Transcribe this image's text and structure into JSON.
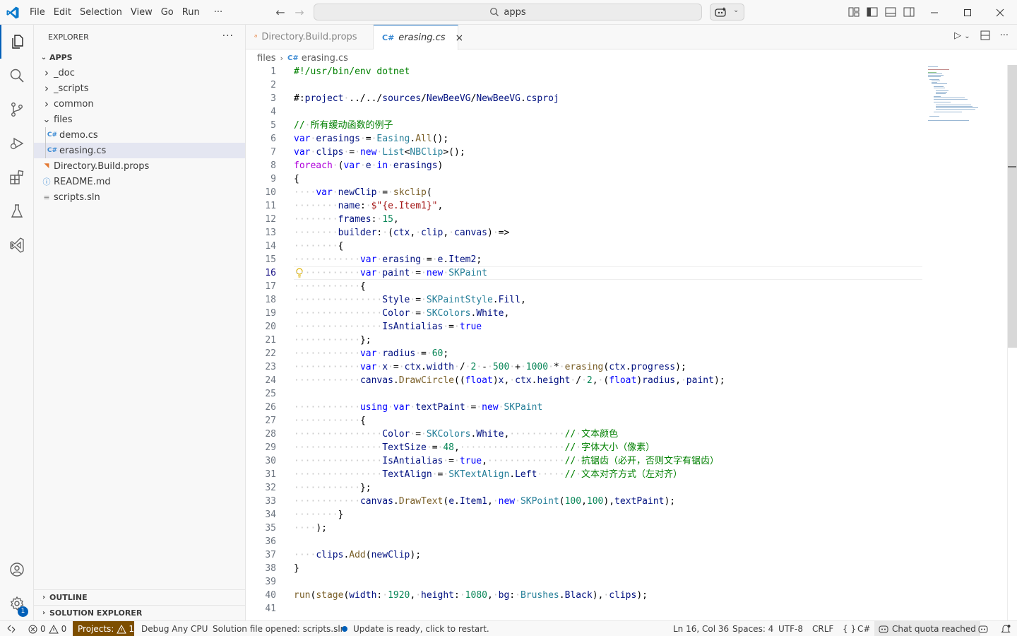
{
  "titlebar": {
    "menus": [
      "File",
      "Edit",
      "Selection",
      "View",
      "Go",
      "Run",
      "···"
    ],
    "search_text": "apps"
  },
  "explorer": {
    "title": "EXPLORER",
    "more": "···",
    "root": "APPS",
    "items": [
      {
        "label": "_doc",
        "kind": "folder-collapsed",
        "indent": 0
      },
      {
        "label": "_scripts",
        "kind": "folder-collapsed",
        "indent": 0
      },
      {
        "label": "common",
        "kind": "folder-collapsed",
        "indent": 0
      },
      {
        "label": "files",
        "kind": "folder-open",
        "indent": 0
      },
      {
        "label": "demo.cs",
        "kind": "cs",
        "indent": 1
      },
      {
        "label": "erasing.cs",
        "kind": "cs",
        "indent": 1,
        "selected": true
      },
      {
        "label": "Directory.Build.props",
        "kind": "rss",
        "indent": 0
      },
      {
        "label": "README.md",
        "kind": "info",
        "indent": 0
      },
      {
        "label": "scripts.sln",
        "kind": "lines",
        "indent": 0
      }
    ],
    "outline": "OUTLINE",
    "solution_explorer": "SOLUTION EXPLORER"
  },
  "tabs": [
    {
      "label": "Directory.Build.props",
      "icon": "rss-icon"
    },
    {
      "label": "erasing.cs",
      "icon": "csharp-icon",
      "close": "×"
    }
  ],
  "breadcrumb": {
    "folder": "files",
    "file": "erasing.cs"
  },
  "editor": {
    "cursor_line": 16,
    "lines": [
      "#!/usr/bin/env dotnet",
      "",
      "#:project ../../sources/NewBeeVG/NewBeeVG.csproj",
      "",
      "// 所有缓动函数的例子",
      "var erasings = Easing.All();",
      "var clips = new List<NBClip>();",
      "foreach (var e in erasings)",
      "{",
      "    var newClip = skclip(",
      "        name: $\"{e.Item1}\",",
      "        frames: 15,",
      "        builder: (ctx, clip, canvas) =>",
      "        {",
      "            var erasing = e.Item2;",
      "            var paint = new SKPaint",
      "            {",
      "                Style = SKPaintStyle.Fill,",
      "                Color = SKColors.White,",
      "                IsAntialias = true",
      "            };",
      "            var radius = 60;",
      "            var x = ctx.width / 2 - 500 + 1000 * erasing(ctx.progress);",
      "            canvas.DrawCircle((float)x, ctx.height / 2, (float)radius, paint);",
      "",
      "            using var textPaint = new SKPaint",
      "            {",
      "                Color = SKColors.White,          // 文本颜色",
      "                TextSize = 48,                   // 字体大小（像素）",
      "                IsAntialias = true,              // 抗锯齿（必开，否则文字有锯齿）",
      "                TextAlign = SKTextAlign.Left     // 文本对齐方式（左对齐）",
      "            };",
      "            canvas.DrawText(e.Item1, new SKPoint(100,100),textPaint);",
      "        }",
      "    );",
      "",
      "    clips.Add(newClip);",
      "}",
      "",
      "run(stage(width: 1920, height: 1080, bg: Brushes.Black), clips);",
      ""
    ]
  },
  "statusbar": {
    "errors": "0",
    "warnings": "0",
    "projects": "Projects:",
    "projects_warn": "1",
    "debug": "Debug Any CPU",
    "solution": "Solution file opened: scripts.sln",
    "update": "Update is ready, click to restart.",
    "position": "Ln 16, Col 36",
    "spaces": "Spaces: 4",
    "encoding": "UTF-8",
    "eol": "CRLF",
    "braces": "{ }",
    "language": "C#",
    "chat": "Chat quota reached",
    "settings_badge": "1"
  },
  "colors": {
    "accent": "#005fb8",
    "warning_bg": "#7d4e00"
  }
}
